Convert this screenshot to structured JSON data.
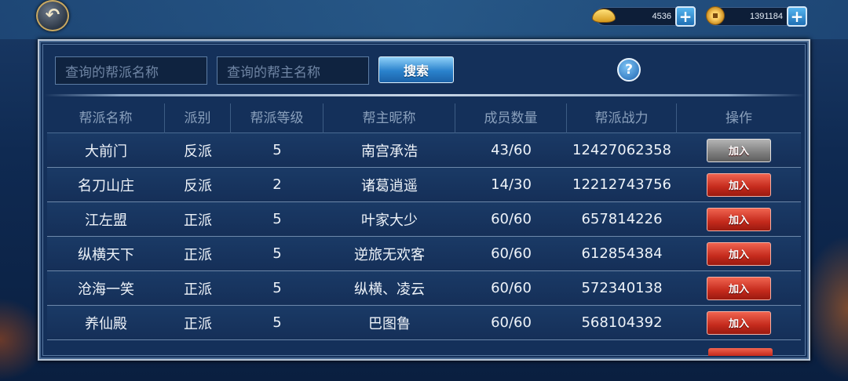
{
  "currency": {
    "gold_value": "4536",
    "copper_value": "1391184",
    "gold_icon": "gold-ingot-icon",
    "copper_icon": "copper-coin-icon",
    "plus_label": "+"
  },
  "back_button": {
    "icon": "back-arrow-icon",
    "label": "↶"
  },
  "search": {
    "guild_name_placeholder": "查询的帮派名称",
    "leader_name_placeholder": "查询的帮主名称",
    "button_label": "搜索",
    "help_label": "?"
  },
  "table": {
    "headers": [
      "帮派名称",
      "派别",
      "帮派等级",
      "帮主昵称",
      "成员数量",
      "帮派战力",
      "操作"
    ],
    "rows": [
      {
        "name": "大前门",
        "faction": "反派",
        "level": "5",
        "leader": "南宫承浩",
        "members": "43/60",
        "power": "12427062358",
        "action": "加入",
        "state": "disabled"
      },
      {
        "name": "名刀山庄",
        "faction": "反派",
        "level": "2",
        "leader": "诸葛逍遥",
        "members": "14/30",
        "power": "12212743756",
        "action": "加入",
        "state": "active"
      },
      {
        "name": "江左盟",
        "faction": "正派",
        "level": "5",
        "leader": "叶家大少",
        "members": "60/60",
        "power": "657814226",
        "action": "加入",
        "state": "active"
      },
      {
        "name": "纵横天下",
        "faction": "正派",
        "level": "5",
        "leader": "逆旅无欢客",
        "members": "60/60",
        "power": "612854384",
        "action": "加入",
        "state": "active"
      },
      {
        "name": "沧海一笑",
        "faction": "正派",
        "level": "5",
        "leader": "纵横、凌云",
        "members": "60/60",
        "power": "572340138",
        "action": "加入",
        "state": "active"
      },
      {
        "name": "养仙殿",
        "faction": "正派",
        "level": "5",
        "leader": "巴图鲁",
        "members": "60/60",
        "power": "568104392",
        "action": "加入",
        "state": "active"
      }
    ]
  },
  "colors": {
    "join_active": "#c42a1c",
    "join_disabled": "#7e7e7e",
    "search_button": "#2a82cc",
    "panel_bg": "#14305a"
  }
}
